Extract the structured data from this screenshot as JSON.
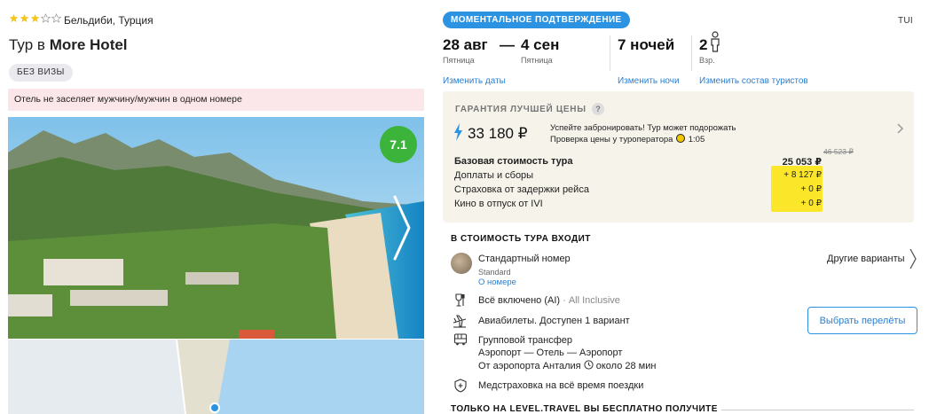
{
  "hotel": {
    "stars_filled": 3,
    "stars_total": 5,
    "location": "Бельдиби, Турция",
    "title_prefix": "Тур в",
    "name": "More Hotel",
    "visa_badge": "БЕЗ ВИЗЫ",
    "notice": "Отель не заселяет мужчину/мужчин в одном номере",
    "rating": "7.1"
  },
  "tour": {
    "instant_badge": "МОМЕНТАЛЬНОЕ ПОДТВЕРЖДЕНИЕ",
    "operator": "TUI",
    "date_from": "28 авг",
    "dash": "—",
    "date_to": "4 сен",
    "day_from": "Пятница",
    "day_to": "Пятница",
    "nights": "7 ночей",
    "adults_count": "2",
    "adults_label": "Взр.",
    "change_dates": "Изменить даты",
    "change_nights": "Изменить ночи",
    "change_tourists": "Изменить состав туристов"
  },
  "price": {
    "guarantee": "ГАРАНТИЯ ЛУЧШЕЙ ЦЕНЫ",
    "help": "?",
    "total": "33 180 ₽",
    "hurry_line1": "Успейте забронировать! Тур может подорожать",
    "hurry_line2": "Проверка цены у туроператора",
    "timer": "1:05",
    "old_price": "46 523 ₽",
    "rows": [
      {
        "label": "Базовая стоимость тура",
        "value": "25 053 ₽"
      },
      {
        "label": "Доплаты и сборы",
        "value": "+ 8 127 ₽"
      },
      {
        "label": "Страховка от задержки рейса",
        "value": "+ 0 ₽"
      },
      {
        "label": "Кино в отпуск от IVI",
        "value": "+ 0 ₽"
      }
    ]
  },
  "included": {
    "title": "В СТОИМОСТЬ ТУРА ВХОДИТ",
    "room_name": "Стандартный номер",
    "room_type": "Standard",
    "room_link": "О номере",
    "other_variants": "Другие варианты",
    "meal": "Всё включено (AI)",
    "meal_sep": " · ",
    "meal_en": "All Inclusive",
    "flights": "Авиабилеты. Доступен 1 вариант",
    "select_flights": "Выбрать перелёты",
    "transfer": "Групповой трансфер",
    "transfer_route": "Аэропорт — Отель — Аэропорт",
    "transfer_from": "От аэропорта Анталия",
    "transfer_time": "около 28 мин",
    "insurance": "Медстраховка на всё время поездки",
    "bottom_title": "ТОЛЬКО НА LEVEL.TRAVEL ВЫ БЕСПЛАТНО ПОЛУЧИТЕ"
  },
  "colors": {
    "accent": "#2c93e2",
    "star": "#f5c518",
    "rating": "#3cb33a",
    "highlight": "#fbe62a",
    "card": "#f5f3ea",
    "notice": "#fbe6ea"
  }
}
